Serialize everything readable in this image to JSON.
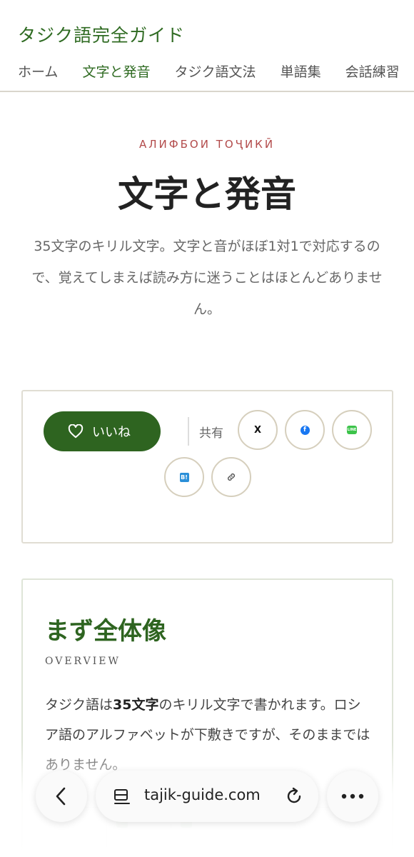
{
  "header": {
    "site_title": "タジク語完全ガイド",
    "nav": [
      "ホーム",
      "文字と発音",
      "タジク語文法",
      "単語集",
      "会話練習"
    ],
    "active_nav_index": 1
  },
  "hero": {
    "kicker": "АЛИФБОИ ТОҶИКӢ",
    "title": "文字と発音",
    "lead": "35文字のキリル文字。文字と音がほぼ1対1で対応するので、覚えてしまえば読み方に迷うことはほとんどありません。"
  },
  "share": {
    "like_label": "いいね",
    "share_label": "共有",
    "x_label": "X",
    "facebook_label": "f",
    "line_label": "LINE",
    "hatena_label": "B!",
    "icons": [
      "heart-icon",
      "x-icon",
      "facebook-icon",
      "line-icon",
      "hatena-bookmark-icon",
      "link-icon"
    ],
    "colors": {
      "accent": "#2e6420",
      "facebook": "#1877f2",
      "line": "#3cc34a",
      "hatena": "#2b8fd8"
    }
  },
  "overview": {
    "title": "まず全体像",
    "subtitle": "OVERVIEW",
    "body_pre": "タジク語は",
    "body_bold": "35文字",
    "body_post": "のキリル文字で書かれます。ロシア語のアルファベットが下敷きですが、そのままではありません。"
  },
  "browser": {
    "url": "tajik-guide.com"
  }
}
